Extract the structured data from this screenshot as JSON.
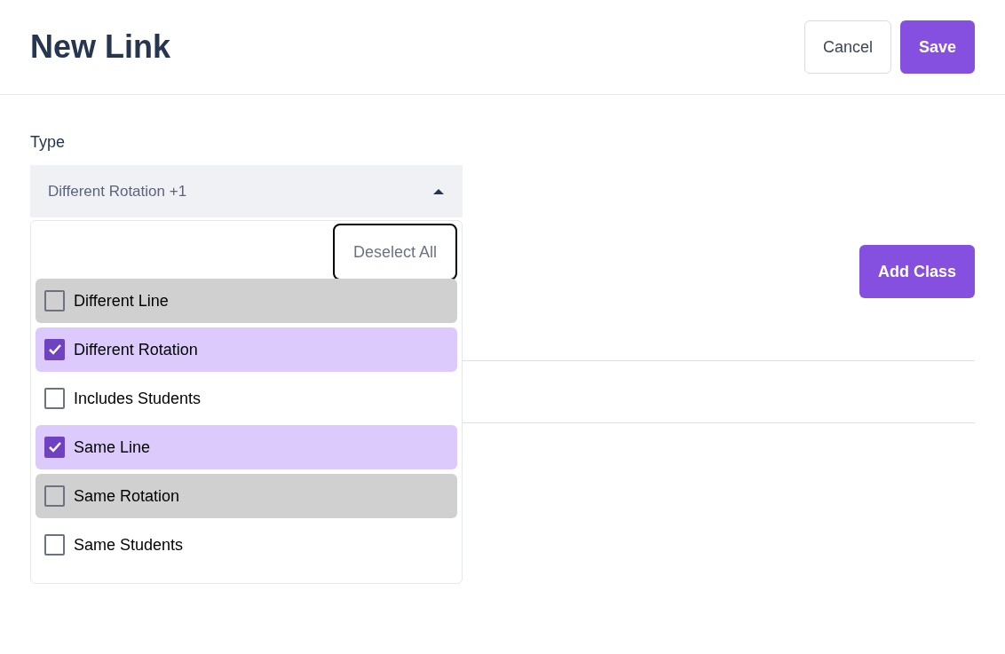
{
  "header": {
    "title": "New Link",
    "buttons": [
      {
        "label": "Cancel",
        "kind": "secondary"
      },
      {
        "label": "Save",
        "kind": "primary"
      }
    ]
  },
  "type_field": {
    "label": "Type",
    "value": "Different Rotation +1",
    "expanded": true
  },
  "dropdown": {
    "deselect_all": "Deselect All",
    "options": [
      {
        "label": "Different Line",
        "checked": false,
        "highlighted": true
      },
      {
        "label": "Different Rotation",
        "checked": true,
        "highlighted": false
      },
      {
        "label": "Includes Students",
        "checked": false,
        "highlighted": false
      },
      {
        "label": "Same Line",
        "checked": true,
        "highlighted": false
      },
      {
        "label": "Same Rotation",
        "checked": false,
        "highlighted": true
      },
      {
        "label": "Same Students",
        "checked": false,
        "highlighted": false
      }
    ]
  },
  "add_class_button": "Add Class"
}
